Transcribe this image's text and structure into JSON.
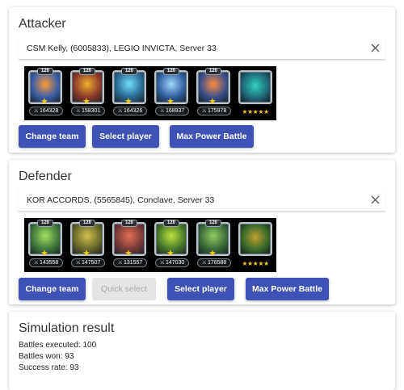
{
  "attacker": {
    "title": "Attacker",
    "player": "CSM Kelly, (6005833), LEGIO INVICTA, Server 33",
    "heroes": [
      {
        "level": "120",
        "power": "164328",
        "color": "#3b5fa8",
        "accent": "#ff9933"
      },
      {
        "level": "120",
        "power": "158301",
        "color": "#8a3a2a",
        "accent": "#f0b030"
      },
      {
        "level": "120",
        "power": "164326",
        "color": "#2a6a90",
        "accent": "#70e0ff"
      },
      {
        "level": "120",
        "power": "168937",
        "color": "#2f5f9f",
        "accent": "#9fd8ff"
      },
      {
        "level": "120",
        "power": "175978",
        "color": "#3a4f8a",
        "accent": "#ff8a40"
      }
    ],
    "pet": {
      "color": "#1f6a7a",
      "accent": "#30d0c0",
      "stars": "★★★★★"
    },
    "buttons": {
      "change_team": "Change team",
      "select_player": "Select player",
      "max_power": "Max Power Battle"
    }
  },
  "defender": {
    "title": "Defender",
    "player": "KOR ACCORDS, (5565845), Conclave, Server 33",
    "heroes": [
      {
        "level": "120",
        "power": "143558",
        "color": "#3f7a3a",
        "accent": "#a0e060"
      },
      {
        "level": "120",
        "power": "147507",
        "color": "#6a6a2a",
        "accent": "#d0c050"
      },
      {
        "level": "120",
        "power": "131557",
        "color": "#7a3a3a",
        "accent": "#e07050"
      },
      {
        "level": "120",
        "power": "147030",
        "color": "#4a7a2a",
        "accent": "#c0e040"
      },
      {
        "level": "120",
        "power": "176588",
        "color": "#3a6a3a",
        "accent": "#90d060"
      }
    ],
    "pet": {
      "color": "#3a6a2a",
      "accent": "#c0a030",
      "stars": "★★★★★"
    },
    "buttons": {
      "change_team": "Change team",
      "quick_select": "Quick select",
      "select_player": "Select player",
      "max_power": "Max Power Battle"
    }
  },
  "result": {
    "title": "Simulation result",
    "battles_executed": "Battles executed: 100",
    "battles_won": "Battles won: 93",
    "success_rate": "Success rate: 93"
  }
}
